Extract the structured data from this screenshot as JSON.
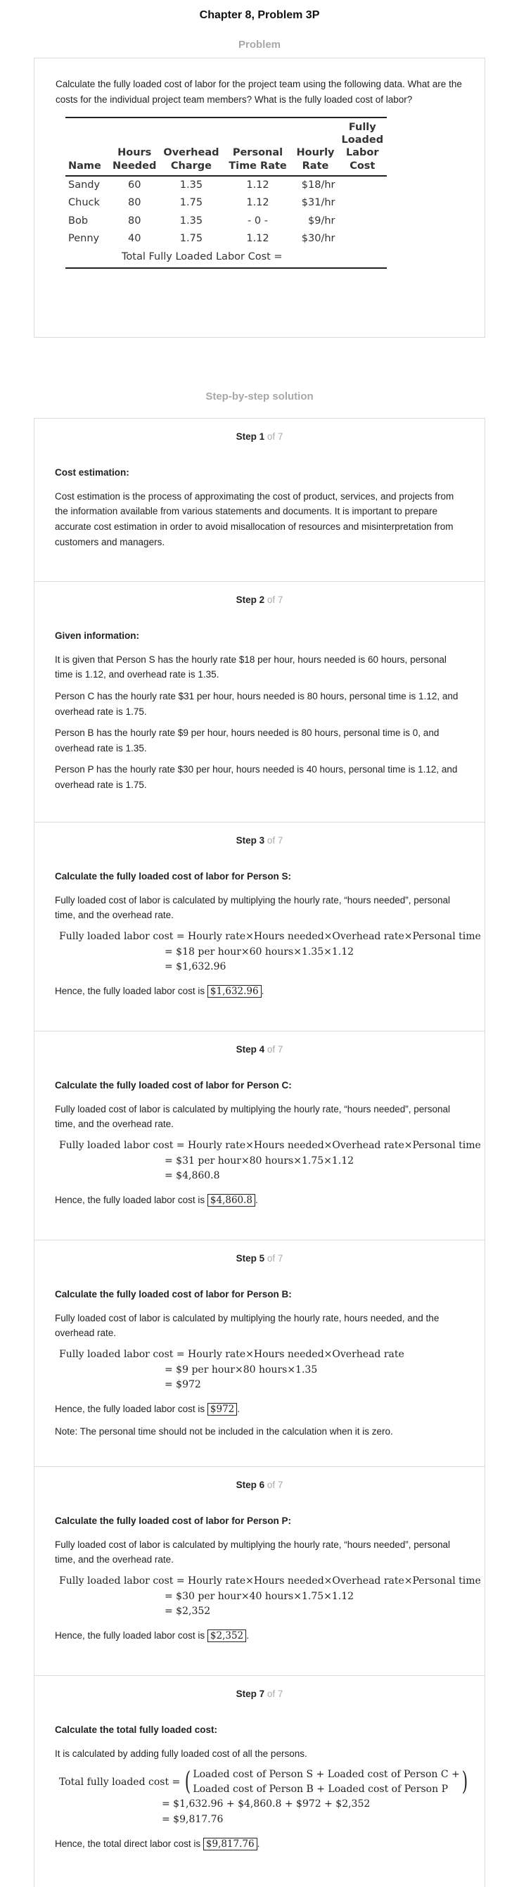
{
  "header": {
    "title": "Chapter 8, Problem 3P"
  },
  "problem": {
    "section_label": "Problem",
    "text": "Calculate the fully loaded cost of labor for the project team using the following data. What are the costs for the individual project team members? What is the fully loaded cost of labor?",
    "table": {
      "headers": [
        "Name",
        "Hours Needed",
        "Overhead Charge",
        "Personal Time Rate",
        "Hourly Rate",
        "Fully Loaded Labor Cost"
      ],
      "rows": [
        [
          "Sandy",
          "60",
          "1.35",
          "1.12",
          "$18/hr",
          ""
        ],
        [
          "Chuck",
          "80",
          "1.75",
          "1.12",
          "$31/hr",
          ""
        ],
        [
          "Bob",
          "80",
          "1.35",
          "- 0 -",
          "$9/hr",
          ""
        ],
        [
          "Penny",
          "40",
          "1.75",
          "1.12",
          "$30/hr",
          ""
        ]
      ],
      "total_label": "Total Fully Loaded Labor Cost ="
    }
  },
  "solution": {
    "section_label": "Step-by-step solution",
    "step_word": "Step",
    "of_word": "of 7",
    "steps": [
      {
        "num": "1",
        "title": "Cost estimation:",
        "paras": [
          "Cost estimation is the process of approximating the cost of product, services, and projects from the information available from various statements and documents. It is important to prepare accurate cost estimation in order to avoid misallocation of resources and misinterpretation from customers and managers."
        ]
      },
      {
        "num": "2",
        "title": "Given information:",
        "paras": [
          "It is given that Person S has the hourly rate $18 per hour, hours needed is 60 hours, personal time is 1.12, and overhead rate is 1.35.",
          "Person C has the hourly rate $31 per hour, hours needed is 80 hours, personal time is 1.12, and overhead rate is 1.75.",
          "Person B has the hourly rate $9 per hour, hours needed is 80 hours, personal time is 0, and overhead rate is 1.35.",
          "Person P has the hourly rate $30 per hour, hours needed is 40 hours, personal time is 1.12, and overhead rate is 1.75."
        ]
      },
      {
        "num": "3",
        "title": "Calculate the fully loaded cost of labor for Person S:",
        "intro": "Fully loaded cost of labor is calculated by multiplying the hourly rate, “hours needed”, personal time, and the overhead rate.",
        "math": [
          "Fully loaded labor cost = Hourly rate×Hours needed×Overhead rate×Personal time",
          "= $18 per hour×60 hours×1.35×1.12",
          "= $1,632.96"
        ],
        "conclusion": "Hence, the fully loaded labor cost is",
        "answer": "$1,632.96"
      },
      {
        "num": "4",
        "title": "Calculate the fully loaded cost of labor for Person C:",
        "intro": "Fully loaded cost of labor is calculated by multiplying the hourly rate, “hours needed”, personal time, and the overhead rate.",
        "math": [
          "Fully loaded labor cost = Hourly rate×Hours needed×Overhead rate×Personal time",
          "= $31 per hour×80 hours×1.75×1.12",
          "= $4,860.8"
        ],
        "conclusion": "Hence, the fully loaded labor cost is",
        "answer": "$4,860.8"
      },
      {
        "num": "5",
        "title": "Calculate the fully loaded cost of labor for Person B:",
        "intro": "Fully loaded cost of labor is calculated by multiplying the hourly rate, hours needed, and the overhead rate.",
        "math": [
          "Fully loaded labor cost = Hourly rate×Hours needed×Overhead rate",
          "= $9 per hour×80 hours×1.35",
          "= $972"
        ],
        "conclusion": "Hence, the fully loaded labor cost is",
        "answer": "$972",
        "note": "Note: The personal time should not be included in the calculation when it is zero."
      },
      {
        "num": "6",
        "title": "Calculate the fully loaded cost of labor for Person P:",
        "intro": "Fully loaded cost of labor is calculated by multiplying the hourly rate, “hours needed”, personal time, and the overhead rate.",
        "math": [
          "Fully loaded labor cost = Hourly rate×Hours needed×Overhead rate×Personal time",
          "= $30 per hour×40 hours×1.75×1.12",
          "= $2,352"
        ],
        "conclusion": "Hence, the fully loaded labor cost is",
        "answer": "$2,352"
      },
      {
        "num": "7",
        "title": "Calculate the total fully loaded cost:",
        "intro": "It is calculated by adding fully loaded cost of all the persons.",
        "math_lhs": "Total fully loaded cost =",
        "math_paren": [
          "Loaded cost of Person S + Loaded cost of Person C +",
          "Loaded cost of Person B + Loaded cost of Person P"
        ],
        "math": [
          "= $1,632.96 + $4,860.8 + $972 + $2,352",
          "= $9,817.76"
        ],
        "conclusion": "Hence, the total direct labor cost is",
        "answer": "$9,817.76"
      }
    ]
  }
}
